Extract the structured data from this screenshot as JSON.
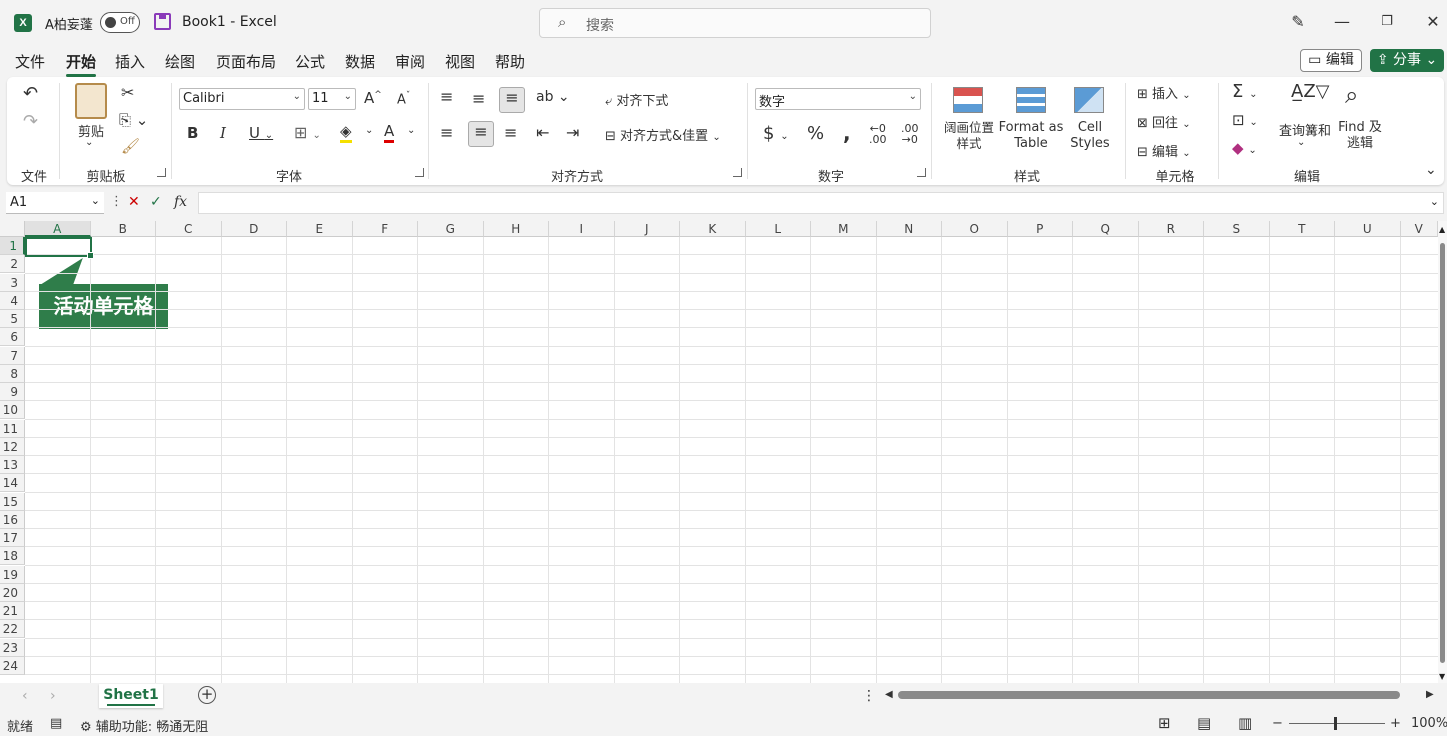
{
  "titlebar": {
    "autosave_label": "A柏妄蓬",
    "autosave_state": "Off",
    "doc_title": "Book1  -  Excel",
    "search_placeholder": "搜索"
  },
  "menu": {
    "items": [
      "文件",
      "开始",
      "插入",
      "绘图",
      "页面布局",
      "公式",
      "数据",
      "审阅",
      "视图",
      "帮助"
    ],
    "active": "开始",
    "edit_label": "编辑",
    "share_label": "分事"
  },
  "ribbon": {
    "groups": {
      "file": "文件",
      "clipboard": "剪贴板",
      "font": "字体",
      "alignment": "对齐方式",
      "number": "数字",
      "styles": "样式",
      "cells": "单元格",
      "editing": "编辑"
    },
    "paste_label": "剪贴",
    "font_name": "Calibri",
    "font_size": "11",
    "wrap_text": "对齐下式",
    "merge_center": "对齐方式&佳置",
    "number_format": "数字",
    "conditional_format": "阔画位置 样式",
    "format_as_table": "Format as Table",
    "cell_styles": "Cell Styles",
    "insert": "插入",
    "delete": "回往",
    "format": "编辑",
    "sort_filter": "査询篝和",
    "find_select": "Find 及 逃辑"
  },
  "formula_bar": {
    "name_box": "A1",
    "fx": "fx"
  },
  "grid": {
    "columns": [
      "A",
      "B",
      "C",
      "D",
      "E",
      "F",
      "G",
      "H",
      "I",
      "J",
      "K",
      "L",
      "M",
      "N",
      "O",
      "P",
      "Q",
      "R",
      "S",
      "T",
      "U",
      "V"
    ],
    "rows": [
      "1",
      "2",
      "3",
      "4",
      "5",
      "6",
      "7",
      "8",
      "9",
      "10",
      "11",
      "12",
      "13",
      "14",
      "15",
      "16",
      "17",
      "18",
      "19",
      "20",
      "21",
      "22",
      "23",
      "24"
    ],
    "active_cell": "A1",
    "callout": "活动单元格"
  },
  "sheets": {
    "tabs": [
      "Sheet1"
    ],
    "active": "Sheet1"
  },
  "status": {
    "ready": "就绪",
    "accessibility": "辅助功能: 畅通无阻",
    "zoom": "100%"
  },
  "colors": {
    "accent": "#217346",
    "callout": "#2f7d4a"
  }
}
